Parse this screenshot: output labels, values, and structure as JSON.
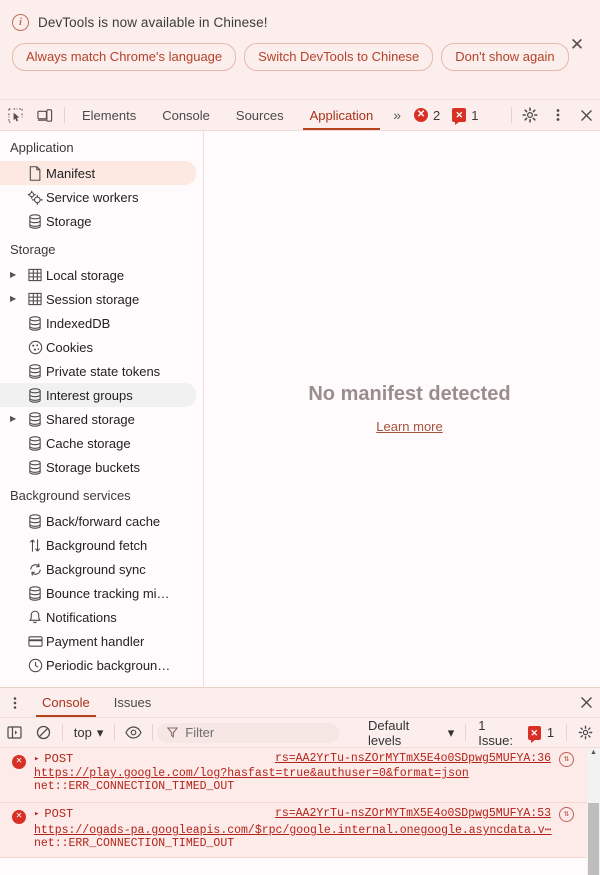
{
  "banner": {
    "info_icon": "info-circle-icon",
    "title": "DevTools is now available in Chinese!",
    "buttons": [
      {
        "label": "Always match Chrome's language",
        "name": "always-match-language-button"
      },
      {
        "label": "Switch DevTools to Chinese",
        "name": "switch-to-chinese-button"
      },
      {
        "label": "Don't show again",
        "name": "dont-show-again-button"
      }
    ],
    "close_label": "✕"
  },
  "toolbar": {
    "inspect_icon": "inspect-element-icon",
    "device_icon": "device-toolbar-icon",
    "tabs": [
      {
        "label": "Elements",
        "active": false
      },
      {
        "label": "Console",
        "active": false
      },
      {
        "label": "Sources",
        "active": false
      },
      {
        "label": "Application",
        "active": true
      }
    ],
    "more_tabs_label": "»",
    "error_count": "2",
    "issue_count": "1",
    "error_badge_glyph": "✕",
    "issue_badge_glyph": "✕",
    "settings_icon": "gear-icon",
    "more_icon": "kebab-menu-icon",
    "close_icon": "close-icon"
  },
  "sidebar": {
    "sections": [
      {
        "title": "Application",
        "items": [
          {
            "label": "Manifest",
            "icon": "document-icon",
            "arrow": false,
            "state": "selected"
          },
          {
            "label": "Service workers",
            "icon": "gears-icon",
            "arrow": false,
            "state": "none"
          },
          {
            "label": "Storage",
            "icon": "database-icon",
            "arrow": false,
            "state": "none"
          }
        ]
      },
      {
        "title": "Storage",
        "items": [
          {
            "label": "Local storage",
            "icon": "table-icon",
            "arrow": true,
            "state": "none"
          },
          {
            "label": "Session storage",
            "icon": "table-icon",
            "arrow": true,
            "state": "none"
          },
          {
            "label": "IndexedDB",
            "icon": "database-icon",
            "arrow": false,
            "state": "none"
          },
          {
            "label": "Cookies",
            "icon": "cookie-icon",
            "arrow": false,
            "state": "none"
          },
          {
            "label": "Private state tokens",
            "icon": "database-icon",
            "arrow": false,
            "state": "none"
          },
          {
            "label": "Interest groups",
            "icon": "database-icon",
            "arrow": false,
            "state": "hovered"
          },
          {
            "label": "Shared storage",
            "icon": "database-icon",
            "arrow": true,
            "state": "none"
          },
          {
            "label": "Cache storage",
            "icon": "database-icon",
            "arrow": false,
            "state": "none"
          },
          {
            "label": "Storage buckets",
            "icon": "database-icon",
            "arrow": false,
            "state": "none"
          }
        ]
      },
      {
        "title": "Background services",
        "items": [
          {
            "label": "Back/forward cache",
            "icon": "database-icon",
            "arrow": false,
            "state": "none"
          },
          {
            "label": "Background fetch",
            "icon": "updown-arrows-icon",
            "arrow": false,
            "state": "none"
          },
          {
            "label": "Background sync",
            "icon": "sync-icon",
            "arrow": false,
            "state": "none"
          },
          {
            "label": "Bounce tracking mi…",
            "icon": "database-icon",
            "arrow": false,
            "state": "none"
          },
          {
            "label": "Notifications",
            "icon": "bell-icon",
            "arrow": false,
            "state": "none"
          },
          {
            "label": "Payment handler",
            "icon": "card-icon",
            "arrow": false,
            "state": "none"
          },
          {
            "label": "Periodic backgroun…",
            "icon": "clock-icon",
            "arrow": false,
            "state": "none"
          }
        ]
      }
    ],
    "scroll_up": "▲",
    "scroll_down": "▼"
  },
  "panel": {
    "empty_title": "No manifest detected",
    "learn_more": "Learn more"
  },
  "drawer": {
    "menu_icon": "kebab-menu-icon",
    "tabs": [
      {
        "label": "Console",
        "active": true
      },
      {
        "label": "Issues",
        "active": false
      }
    ],
    "close_icon": "close-icon",
    "toolbar": {
      "sidebar_toggle_icon": "show-console-sidebar-icon",
      "clear_icon": "clear-console-icon",
      "context_value": "top",
      "context_caret": "▾",
      "eye_icon": "live-expression-icon",
      "filter_icon": "filter-icon",
      "filter_placeholder": "Filter",
      "levels_value": "Default levels",
      "levels_caret": "▾",
      "issues_label": "1 Issue:",
      "issues_count": "1",
      "settings_icon": "gear-icon"
    },
    "messages": [
      {
        "icon": "error-icon",
        "triangle": "▸",
        "method": "POST",
        "source": "rs=AA2YrTu-nsZOrMYTmX5E4o0SDpwg5MUFYA:36",
        "network_icon": "network-request-icon",
        "url": "https://play.google.com/log?hasfast=true&authuser=0&format=json",
        "error": "net::ERR_CONNECTION_TIMED_OUT"
      },
      {
        "icon": "error-icon",
        "triangle": "▸",
        "method": "POST",
        "source": "rs=AA2YrTu-nsZOrMYTmX5E4o0SDpwg5MUFYA:53",
        "network_icon": "network-request-icon",
        "url": "https://ogads-pa.googleapis.com/$rpc/google.internal.onegoogle.asyncdata.v⋯",
        "error": "net::ERR_CONNECTION_TIMED_OUT"
      }
    ]
  },
  "colors": {
    "accent": "#b4431f",
    "banner_bg": "#fbeeec",
    "error_red": "#d93025",
    "selected_row": "#fde9e2"
  }
}
